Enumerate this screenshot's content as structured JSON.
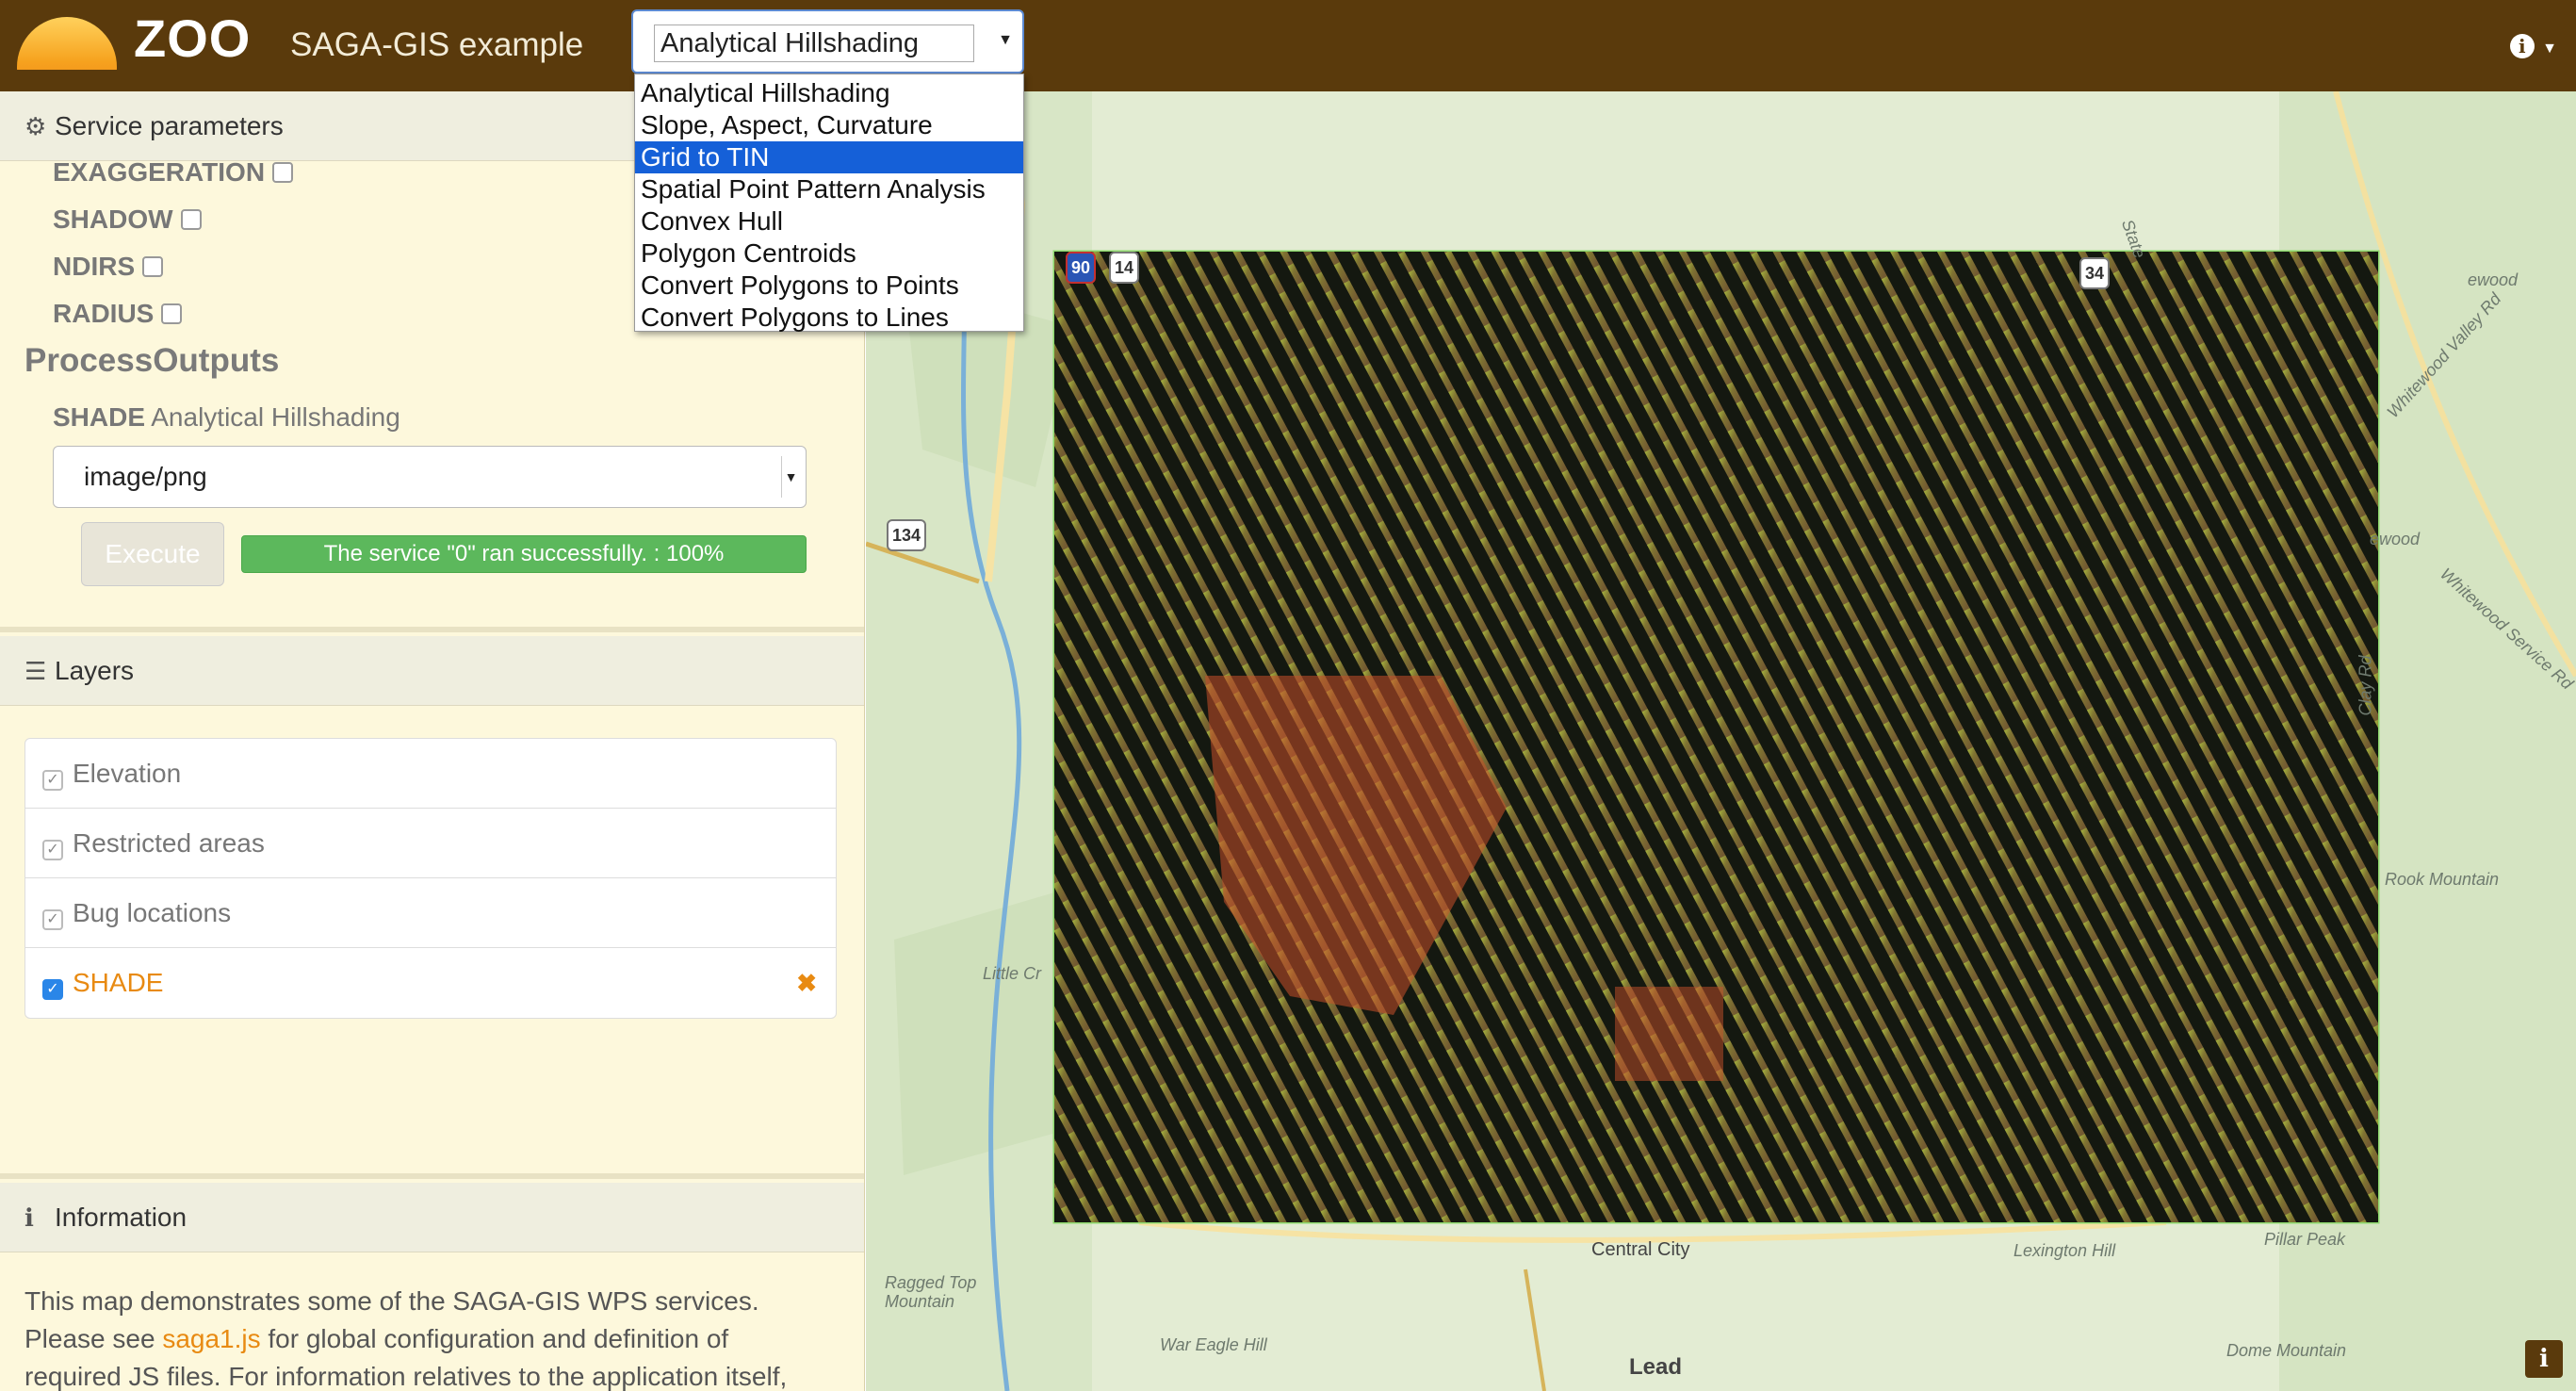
{
  "header": {
    "brand": "ZOO",
    "app_title": "SAGA-GIS example",
    "process_select": {
      "value": "Analytical Hillshading",
      "options": [
        "Analytical Hillshading",
        "Slope, Aspect, Curvature",
        "Grid to TIN",
        "Spatial Point Pattern Analysis",
        "Convex Hull",
        "Polygon Centroids",
        "Convert Polygons to Points",
        "Convert Polygons to Lines"
      ],
      "highlighted": "Grid to TIN"
    }
  },
  "service_params": {
    "title": "Service parameters",
    "params": [
      "EXAGGERATION",
      "SHADOW",
      "NDIRS",
      "RADIUS"
    ],
    "outputs_title": "ProcessOutputs",
    "output_id": "SHADE",
    "output_desc": "Analytical Hillshading",
    "mime": "image/png",
    "execute_label": "Execute",
    "status": "The service \"0\" ran successfully. : 100%",
    "progress": 100
  },
  "layers": {
    "title": "Layers",
    "items": [
      {
        "label": "Elevation",
        "checked": true
      },
      {
        "label": "Restricted areas",
        "checked": true
      },
      {
        "label": "Bug locations",
        "checked": true
      },
      {
        "label": "SHADE",
        "checked": true,
        "active": true
      }
    ]
  },
  "information": {
    "title": "Information",
    "line1": "This map demonstrates some of the SAGA-GIS WPS services.",
    "line2_prefix": "Please see ",
    "link": "saga1.js",
    "line2_suffix": " for global configuration and definition of",
    "line3": "required JS files. For information relatives to the application itself,"
  },
  "map": {
    "shields": [
      "90",
      "14",
      "34",
      "134"
    ],
    "labels": [
      "Whitewood Valley Rd",
      "Whitewood Service Rd",
      "Rook Mountain",
      "Pillar Peak",
      "Lexington Hill",
      "Central City",
      "Lead",
      "Dome Mountain",
      "War Eagle Hill",
      "Ragged Top Mountain",
      "Little Cr",
      "State",
      "ewood",
      "ewood",
      "Clay Rd"
    ]
  },
  "colors": {
    "navbar": "#5a3a0c",
    "accent": "#e88a12",
    "sidebar_bg": "#fdf8dc",
    "success": "#5cb85c"
  },
  "icons": {
    "params": "gears-icon",
    "layers": "list-icon",
    "info": "info-circle-icon"
  }
}
